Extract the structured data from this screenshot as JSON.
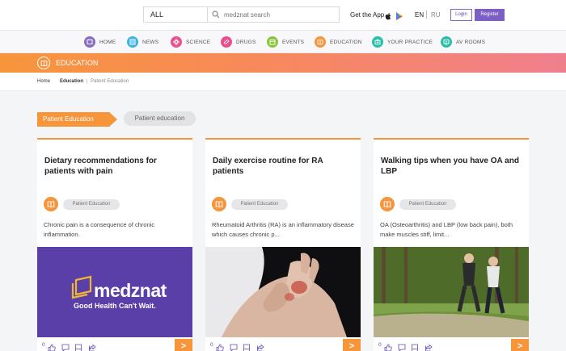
{
  "header": {
    "search_scope": "ALL",
    "search_placeholder": "medznat search",
    "get_app_label": "Get the App",
    "lang_en": "EN",
    "lang_ru": "RU",
    "login_label": "Login",
    "register_label": "Register"
  },
  "nav": {
    "items": [
      {
        "label": "HOME",
        "color": "#8a6cc6"
      },
      {
        "label": "NEWS",
        "color": "#3bb3e3"
      },
      {
        "label": "SCIENCE",
        "color": "#e9508d"
      },
      {
        "label": "DRUGS",
        "color": "#e9508d"
      },
      {
        "label": "EVENTS",
        "color": "#8cc43e"
      },
      {
        "label": "EDUCATION",
        "color": "#f7953b"
      },
      {
        "label": "YOUR PRACTICE",
        "color": "#2cbfa7"
      },
      {
        "label": "AV ROOMS",
        "color": "#2cbfa7"
      }
    ]
  },
  "section": {
    "title": "EDUCATION"
  },
  "breadcrumb": {
    "home": "Home",
    "education": "Education",
    "separator": "|",
    "current": "Patient Education"
  },
  "tags": {
    "active": "Patient Education",
    "other": "Patient education"
  },
  "cards": [
    {
      "title": "Dietary recommendations for patients with pain",
      "category": "Patient Education",
      "excerpt": "Chronic pain is a consequence of chronic inflammation.",
      "image_logo": "medznat",
      "image_tagline": "Good Health Can't Wait.",
      "likes": "0"
    },
    {
      "title": "Daily exercise routine for RA patients",
      "category": "Patient Education",
      "excerpt": "Rheumatoid Arthritis (RA) is an inflammatory disease which causes chronic p...",
      "likes": "0"
    },
    {
      "title": "Walking tips when you have OA and LBP",
      "category": "Patient Education",
      "excerpt": "OA (Osteoarthritis) and LBP (low back pain), both make muscles stiff, limit...",
      "likes": "0"
    }
  ],
  "more_symbol": ">"
}
